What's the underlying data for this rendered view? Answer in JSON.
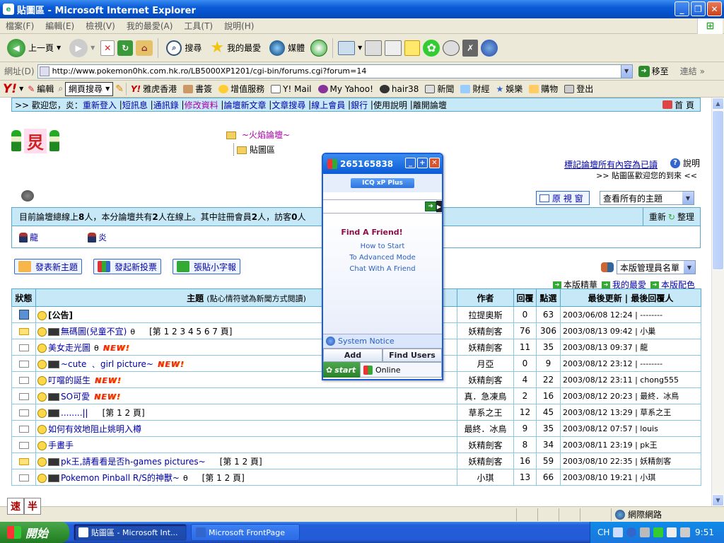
{
  "window": {
    "title": "貼圖區 - Microsoft Internet Explorer",
    "min": "_",
    "max": "❐",
    "close": "✕"
  },
  "menu": [
    "檔案(F)",
    "編輯(E)",
    "檢視(V)",
    "我的最愛(A)",
    "工具(T)",
    "說明(H)"
  ],
  "toolbar": {
    "back": "上一頁",
    "search": "搜尋",
    "favorites": "我的最愛",
    "media": "媒體"
  },
  "address": {
    "label": "網址(D)",
    "url": "http://www.pokemon0hk.com.hk.ro/LB5000XP1201/cgi-bin/forums.cgi?forum=14",
    "go": "移至",
    "links": "連結"
  },
  "yahoo_bar": {
    "logo": "Y!",
    "edit": "編輯",
    "search_select": "網頁搜尋",
    "items": [
      "雅虎香港",
      "書簽",
      "增值服務",
      "Y! Mail",
      "My Yahoo!",
      "hair38",
      "新聞",
      "財經",
      "娛樂",
      "購物",
      "登出"
    ]
  },
  "welcome": {
    "prefix": ">> 歡迎您，炎：",
    "links": [
      "重新登入",
      "短訊息",
      "通訊錄",
      "修改資料",
      "論壇新文章",
      "文章搜尋",
      "線上會員",
      "銀行",
      "使用說明",
      "離開論壇"
    ],
    "home": "首 頁"
  },
  "logo_text": "炅",
  "tree": {
    "parent": "~火焰論壇~",
    "current": "貼圖區"
  },
  "mark_read": "標記論壇所有內容為已讀",
  "help": "說明",
  "tagline": ">> 貼圖區歡迎您的到來 <<",
  "view_button": "原 視 窗",
  "topic_select": "查看所有的主題",
  "online_info": {
    "p1": "目前論壇總線上 ",
    "total": "8",
    "p2": " 人，本分論壇共有 ",
    "forum": "2",
    "p3": " 人在線上。其中註冊會員 ",
    "members": "2",
    "p4": " 人，訪客 ",
    "guests": "0",
    "p5": " 人",
    "refresh": "重新",
    "arrange": "整理"
  },
  "online_users": [
    "龍",
    "炎"
  ],
  "actions": [
    "發表新主題",
    "發起新投票",
    "張貼小字報"
  ],
  "admin_select": "本版管理員名單",
  "sublinks": [
    "本版精華",
    "我的最愛",
    "本版配色"
  ],
  "table": {
    "headers": {
      "status": "狀態",
      "topic": "主題",
      "topic_note": "(點心情符號為新聞方式閱讀)",
      "author": "作者",
      "replies": "回覆",
      "views": "點選",
      "last": "最後更新 | 最後回覆人"
    },
    "rows": [
      {
        "status": "pin",
        "title": "[公告]",
        "link": false,
        "clip": "",
        "pages": "",
        "new": "",
        "author": "拉提奧斯",
        "replies": "0",
        "views": "63",
        "last": "2003/06/08 12:24 | --------"
      },
      {
        "status": "hot",
        "title": "無碼圖(兒童不宜)",
        "link": true,
        "clip": "θ",
        "pages": "[第 1 2 3 4 5 6 7 頁]",
        "new": "",
        "author": "妖精劍客",
        "replies": "76",
        "views": "306",
        "last": "2003/08/13 09:42 | 小巢"
      },
      {
        "status": "normal",
        "title": "美女走光圖",
        "link": true,
        "clip": "θ",
        "pages": "",
        "new": "NEW!",
        "author": "妖精劍客",
        "replies": "11",
        "views": "35",
        "last": "2003/08/13 09:37 | 龍"
      },
      {
        "status": "normal",
        "title": "~cute ﹑ girl picture~",
        "link": true,
        "clip": "",
        "pages": "",
        "new": "NEW!",
        "author": "月亞",
        "replies": "0",
        "views": "9",
        "last": "2003/08/12 23:12 | --------"
      },
      {
        "status": "normal",
        "title": "叮噹的誕生",
        "link": true,
        "clip": "",
        "pages": "",
        "new": "NEW!",
        "author": "妖精劍客",
        "replies": "4",
        "views": "22",
        "last": "2003/08/12 23:11 | chong555"
      },
      {
        "status": "normal",
        "title": "SO可愛",
        "link": true,
        "clip": "",
        "pages": "",
        "new": "NEW!",
        "author": "真．急凍鳥",
        "replies": "2",
        "views": "16",
        "last": "2003/08/12 20:23 | 最終．冰鳥"
      },
      {
        "status": "normal",
        "title": "........||",
        "link": true,
        "clip": "",
        "pages": "[第 1 2 頁]",
        "new": "",
        "author": "草系之王",
        "replies": "12",
        "views": "45",
        "last": "2003/08/12 13:29 | 草系之王"
      },
      {
        "status": "normal",
        "title": "如何有效地阻止姚明入樽",
        "link": true,
        "clip": "",
        "pages": "",
        "new": "",
        "author": "最終．冰鳥",
        "replies": "9",
        "views": "35",
        "last": "2003/08/12 07:57 | louis"
      },
      {
        "status": "normal",
        "title": "手畫手",
        "link": true,
        "clip": "",
        "pages": "",
        "new": "",
        "author": "妖精劍客",
        "replies": "8",
        "views": "34",
        "last": "2003/08/11 23:19 | pk王"
      },
      {
        "status": "hot",
        "title": "pk王,請看看是否h-games pictures~",
        "link": true,
        "clip": "",
        "pages": "[第 1 2 頁]",
        "new": "",
        "author": "妖精劍客",
        "replies": "16",
        "views": "59",
        "last": "2003/08/10 22:35 | 妖精劍客"
      },
      {
        "status": "normal",
        "title": "Pokemon Pinball R/S的神獸~",
        "link": true,
        "clip": "θ",
        "pages": "[第 1 2 頁]",
        "new": "",
        "author": "小琪",
        "replies": "13",
        "views": "66",
        "last": "2003/08/10 19:21 | 小琪"
      }
    ]
  },
  "status_bar": {
    "zone": "網際網路"
  },
  "ime": [
    "速",
    "半"
  ],
  "icq": {
    "title": "265165838",
    "brand": "ICQ xP Plus",
    "find_friend": "Find A Friend!",
    "links": [
      "How to Start",
      "To Advanced Mode",
      "Chat With A Friend"
    ],
    "notice": "System Notice",
    "add": "Add",
    "find_users": "Find Users",
    "start": "start",
    "status": "Online"
  },
  "taskbar": {
    "start": "開始",
    "tasks": [
      "貼圖區 - Microsoft Int...",
      "Microsoft FrontPage"
    ],
    "lang": "CH",
    "clock": "9:51"
  }
}
